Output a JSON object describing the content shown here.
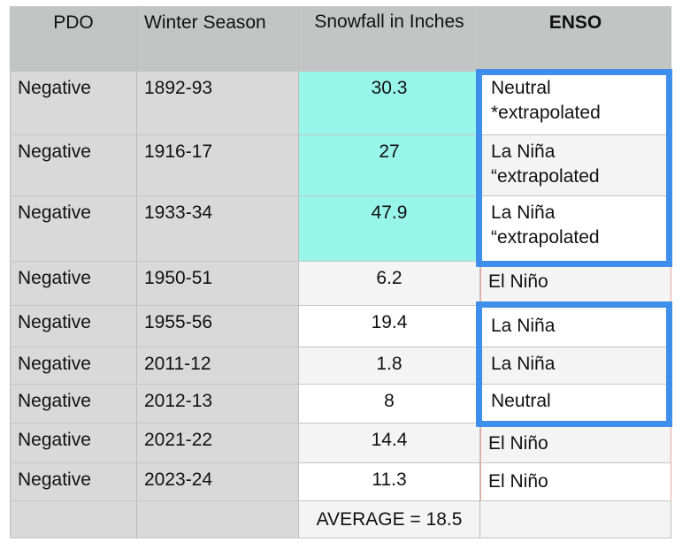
{
  "table": {
    "headers": [
      "PDO",
      "Winter Season",
      "Snowfall in Inches",
      "ENSO"
    ],
    "rows": [
      {
        "pdo": "Negative",
        "season": "1892-93",
        "snowfall": "30.3",
        "enso": "Neutral *extrapolated"
      },
      {
        "pdo": "Negative",
        "season": "1916-17",
        "snowfall": "27",
        "enso": "La Niña “extrapolated"
      },
      {
        "pdo": "Negative",
        "season": "1933-34",
        "snowfall": "47.9",
        "enso": "La Niña “extrapolated"
      },
      {
        "pdo": "Negative",
        "season": "1950-51",
        "snowfall": "6.2",
        "enso": "El Niño"
      },
      {
        "pdo": "Negative",
        "season": "1955-56",
        "snowfall": "19.4",
        "enso": "La Niña"
      },
      {
        "pdo": "Negative",
        "season": "2011-12",
        "snowfall": "1.8",
        "enso": "La Niña"
      },
      {
        "pdo": "Negative",
        "season": "2012-13",
        "snowfall": "8",
        "enso": "Neutral"
      },
      {
        "pdo": "Negative",
        "season": "2021-22",
        "snowfall": "14.4",
        "enso": "El Niño"
      },
      {
        "pdo": "Negative",
        "season": "2023-24",
        "snowfall": "11.3",
        "enso": "El Niño"
      }
    ],
    "footer": {
      "pdo": "",
      "season": "",
      "snowfall": "AVERAGE = 18.5",
      "enso": ""
    }
  },
  "colors": {
    "highlight_teal": "#98f5e9",
    "selection_blue": "#3e8fec",
    "header_grey": "#c3c4c4"
  }
}
